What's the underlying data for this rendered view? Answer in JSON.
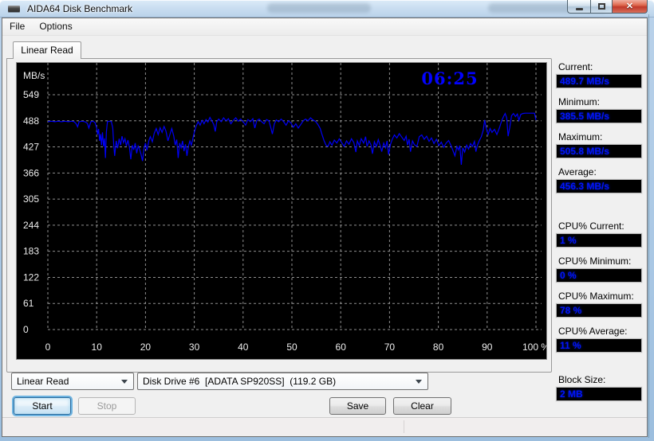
{
  "window": {
    "title": "AIDA64 Disk Benchmark",
    "caption_buttons": {
      "minimize": "minimize",
      "maximize": "maximize",
      "close": "close"
    }
  },
  "menu": {
    "items": [
      {
        "label": "File"
      },
      {
        "label": "Options"
      }
    ]
  },
  "tabs": [
    {
      "label": "Linear Read"
    }
  ],
  "chart_data": {
    "type": "line",
    "title": "Linear Read disk benchmark",
    "ylabel": "MB/s",
    "xlabel": "%",
    "elapsed_time": "06:25",
    "x_range": [
      0,
      100
    ],
    "y_range": [
      0,
      580
    ],
    "grid": "on",
    "legend": "none",
    "bg_color": "#000000",
    "grid_color": "#8f8f8f",
    "line_color": "#0000f4",
    "axis_text_color": "#ededed",
    "timer_color": "#0202ff",
    "x_ticks": [
      {
        "pos": 0,
        "label": "0"
      },
      {
        "pos": 10,
        "label": "10"
      },
      {
        "pos": 20,
        "label": "20"
      },
      {
        "pos": 30,
        "label": "30"
      },
      {
        "pos": 40,
        "label": "40"
      },
      {
        "pos": 50,
        "label": "50"
      },
      {
        "pos": 60,
        "label": "60"
      },
      {
        "pos": 70,
        "label": "70"
      },
      {
        "pos": 80,
        "label": "80"
      },
      {
        "pos": 90,
        "label": "90"
      },
      {
        "pos": 100,
        "label": "100 %"
      }
    ],
    "y_ticks": [
      {
        "pos": 0,
        "label": "0"
      },
      {
        "pos": 61,
        "label": "61"
      },
      {
        "pos": 122,
        "label": "122"
      },
      {
        "pos": 183,
        "label": "183"
      },
      {
        "pos": 244,
        "label": "244"
      },
      {
        "pos": 305,
        "label": "305"
      },
      {
        "pos": 366,
        "label": "366"
      },
      {
        "pos": 427,
        "label": "427"
      },
      {
        "pos": 488,
        "label": "488"
      },
      {
        "pos": 549,
        "label": "549"
      }
    ],
    "series": [
      {
        "name": "Linear Read (MB/s)",
        "points": [
          [
            0,
            486
          ],
          [
            0.7,
            487
          ],
          [
            1.4,
            486
          ],
          [
            2.1,
            487
          ],
          [
            2.8,
            486
          ],
          [
            3.5,
            487
          ],
          [
            4.2,
            486
          ],
          [
            4.9,
            487
          ],
          [
            5.4,
            486
          ],
          [
            5.8,
            481
          ],
          [
            6.1,
            474
          ],
          [
            6.4,
            486
          ],
          [
            7,
            487
          ],
          [
            7.6,
            486
          ],
          [
            8.1,
            482
          ],
          [
            8.4,
            471
          ],
          [
            8.8,
            486
          ],
          [
            9.3,
            487
          ],
          [
            9.7,
            483
          ],
          [
            10,
            471
          ],
          [
            10.2,
            456
          ],
          [
            10.4,
            469
          ],
          [
            10.6,
            441
          ],
          [
            10.8,
            457
          ],
          [
            11,
            431
          ],
          [
            11.2,
            461
          ],
          [
            11.4,
            428
          ],
          [
            11.6,
            447
          ],
          [
            11.8,
            401
          ],
          [
            12,
            462
          ],
          [
            12.2,
            486
          ],
          [
            12.6,
            487
          ],
          [
            13,
            486
          ],
          [
            13.3,
            471
          ],
          [
            13.5,
            432
          ],
          [
            13.7,
            406
          ],
          [
            14,
            441
          ],
          [
            14.3,
            424
          ],
          [
            14.6,
            446
          ],
          [
            14.9,
            431
          ],
          [
            15.2,
            452
          ],
          [
            15.5,
            437
          ],
          [
            15.8,
            446
          ],
          [
            16.1,
            429
          ],
          [
            16.4,
            443
          ],
          [
            16.7,
            427
          ],
          [
            17,
            398
          ],
          [
            17.3,
            431
          ],
          [
            17.6,
            420
          ],
          [
            17.9,
            436
          ],
          [
            18.2,
            412
          ],
          [
            18.5,
            429
          ],
          [
            18.8,
            421
          ],
          [
            19.1,
            409
          ],
          [
            19.4,
            394
          ],
          [
            19.7,
            424
          ],
          [
            20,
            436
          ],
          [
            20.3,
            419
          ],
          [
            20.7,
            442
          ],
          [
            21,
            451
          ],
          [
            21.4,
            439
          ],
          [
            21.8,
            459
          ],
          [
            22.2,
            470
          ],
          [
            22.6,
            456
          ],
          [
            23,
            472
          ],
          [
            23.4,
            461
          ],
          [
            23.8,
            475
          ],
          [
            24.2,
            464
          ],
          [
            24.6,
            441
          ],
          [
            25,
            456
          ],
          [
            25.4,
            470
          ],
          [
            25.8,
            452
          ],
          [
            26.1,
            431
          ],
          [
            26.4,
            444
          ],
          [
            26.7,
            401
          ],
          [
            27,
            436
          ],
          [
            27.3,
            425
          ],
          [
            27.6,
            441
          ],
          [
            27.9,
            417
          ],
          [
            28.2,
            433
          ],
          [
            28.5,
            406
          ],
          [
            28.8,
            429
          ],
          [
            29.1,
            441
          ],
          [
            29.4,
            431
          ],
          [
            29.7,
            446
          ],
          [
            30,
            461
          ],
          [
            30.4,
            476
          ],
          [
            30.8,
            486
          ],
          [
            31.2,
            478
          ],
          [
            31.6,
            489
          ],
          [
            32,
            481
          ],
          [
            32.4,
            491
          ],
          [
            32.8,
            485
          ],
          [
            33.2,
            496
          ],
          [
            33.6,
            488
          ],
          [
            34,
            479
          ],
          [
            34.3,
            463
          ],
          [
            34.6,
            486
          ],
          [
            35,
            492
          ],
          [
            35.5,
            486
          ],
          [
            36,
            495
          ],
          [
            36.5,
            488
          ],
          [
            37,
            493
          ],
          [
            37.5,
            481
          ],
          [
            38,
            489
          ],
          [
            38.5,
            495
          ],
          [
            39,
            487
          ],
          [
            39.5,
            492
          ],
          [
            40,
            486
          ],
          [
            40.5,
            478
          ],
          [
            41,
            491
          ],
          [
            41.5,
            486
          ],
          [
            42,
            493
          ],
          [
            42.4,
            471
          ],
          [
            42.8,
            488
          ],
          [
            43.3,
            492
          ],
          [
            43.8,
            486
          ],
          [
            44.3,
            481
          ],
          [
            44.8,
            491
          ],
          [
            45.3,
            488
          ],
          [
            45.7,
            471
          ],
          [
            46,
            457
          ],
          [
            46.4,
            481
          ],
          [
            46.8,
            490
          ],
          [
            47.3,
            486
          ],
          [
            47.8,
            492
          ],
          [
            48.3,
            486
          ],
          [
            48.8,
            478
          ],
          [
            49.3,
            488
          ],
          [
            49.8,
            483
          ],
          [
            50.3,
            473
          ],
          [
            50.8,
            481
          ],
          [
            51.3,
            471
          ],
          [
            51.8,
            479
          ],
          [
            52.3,
            488
          ],
          [
            52.8,
            492
          ],
          [
            53.3,
            488
          ],
          [
            53.8,
            495
          ],
          [
            54.3,
            490
          ],
          [
            54.8,
            487
          ],
          [
            55.3,
            480
          ],
          [
            55.8,
            470
          ],
          [
            56.2,
            455
          ],
          [
            56.6,
            441
          ],
          [
            57,
            431
          ],
          [
            57.4,
            428
          ],
          [
            57.8,
            439
          ],
          [
            58.2,
            431
          ],
          [
            58.7,
            443
          ],
          [
            59.2,
            436
          ],
          [
            59.7,
            446
          ],
          [
            60.2,
            437
          ],
          [
            60.7,
            428
          ],
          [
            61.2,
            441
          ],
          [
            61.7,
            433
          ],
          [
            62.2,
            446
          ],
          [
            62.7,
            437
          ],
          [
            63.1,
            415
          ],
          [
            63.4,
            441
          ],
          [
            63.8,
            430
          ],
          [
            64.2,
            446
          ],
          [
            64.7,
            436
          ],
          [
            65.1,
            451
          ],
          [
            65.4,
            428
          ],
          [
            65.8,
            441
          ],
          [
            66.2,
            432
          ],
          [
            66.5,
            411
          ],
          [
            66.9,
            439
          ],
          [
            67.3,
            428
          ],
          [
            67.7,
            444
          ],
          [
            68.1,
            429
          ],
          [
            68.4,
            416
          ],
          [
            68.8,
            436
          ],
          [
            69.2,
            425
          ],
          [
            69.5,
            441
          ],
          [
            69.8,
            409
          ],
          [
            70.2,
            433
          ],
          [
            70.6,
            446
          ],
          [
            71,
            455
          ],
          [
            71.5,
            448
          ],
          [
            72,
            458
          ],
          [
            72.5,
            450
          ],
          [
            73,
            442
          ],
          [
            73.4,
            452
          ],
          [
            73.7,
            431
          ],
          [
            74,
            445
          ],
          [
            74.3,
            416
          ],
          [
            74.7,
            441
          ],
          [
            75.1,
            432
          ],
          [
            75.6,
            428
          ],
          [
            76.1,
            451
          ],
          [
            76.6,
            455
          ],
          [
            77.1,
            445
          ],
          [
            77.6,
            452
          ],
          [
            78.1,
            440
          ],
          [
            78.6,
            448
          ],
          [
            79.1,
            435
          ],
          [
            79.6,
            445
          ],
          [
            80.1,
            430
          ],
          [
            80.6,
            438
          ],
          [
            81.1,
            426
          ],
          [
            81.6,
            436
          ],
          [
            82.1,
            442
          ],
          [
            82.6,
            430
          ],
          [
            83,
            418
          ],
          [
            83.4,
            406
          ],
          [
            83.8,
            428
          ],
          [
            84.1,
            420
          ],
          [
            84.4,
            430
          ],
          [
            84.7,
            385.5
          ],
          [
            85,
            425
          ],
          [
            85.4,
            415
          ],
          [
            85.8,
            431
          ],
          [
            86.2,
            422
          ],
          [
            86.6,
            435
          ],
          [
            87,
            428
          ],
          [
            87.4,
            440
          ],
          [
            87.7,
            416
          ],
          [
            88,
            431
          ],
          [
            88.4,
            442
          ],
          [
            88.8,
            451
          ],
          [
            89.2,
            466
          ],
          [
            89.5,
            490
          ],
          [
            89.8,
            471
          ],
          [
            90.2,
            456
          ],
          [
            90.6,
            470
          ],
          [
            91,
            461
          ],
          [
            91.5,
            468
          ],
          [
            92,
            456
          ],
          [
            92.5,
            471
          ],
          [
            93,
            489
          ],
          [
            93.4,
            499
          ],
          [
            93.7,
            505
          ],
          [
            94,
            495
          ],
          [
            94.3,
            452
          ],
          [
            94.6,
            471
          ],
          [
            95,
            500
          ],
          [
            95.4,
            505
          ],
          [
            95.8,
            498
          ],
          [
            96.2,
            504
          ],
          [
            96.5,
            489
          ],
          [
            96.9,
            503
          ],
          [
            97.3,
            505
          ],
          [
            97.8,
            505.8
          ],
          [
            98.3,
            505.8
          ],
          [
            98.8,
            505.8
          ],
          [
            99.3,
            505.8
          ],
          [
            99.7,
            505.8
          ],
          [
            100,
            489.7
          ]
        ]
      }
    ]
  },
  "stats": {
    "groups": [
      {
        "label": "Current:",
        "value": "489.7 MB/s"
      },
      {
        "label": "Minimum:",
        "value": "385.5 MB/s"
      },
      {
        "label": "Maximum:",
        "value": "505.8 MB/s"
      },
      {
        "label": "Average:",
        "value": "456.3 MB/s"
      },
      {
        "label": "CPU% Current:",
        "value": "1 %"
      },
      {
        "label": "CPU% Minimum:",
        "value": "0 %"
      },
      {
        "label": "CPU% Maximum:",
        "value": "78 %"
      },
      {
        "label": "CPU% Average:",
        "value": "11 %"
      },
      {
        "label": "Block Size:",
        "value": "2 MB"
      }
    ]
  },
  "controls": {
    "test_type_select": {
      "value": "Linear Read"
    },
    "drive_select": {
      "value": "Disk Drive #6  [ADATA SP920SS]  (119.2 GB)"
    },
    "start_button": "Start",
    "stop_button": "Stop",
    "save_button": "Save",
    "clear_button": "Clear"
  }
}
